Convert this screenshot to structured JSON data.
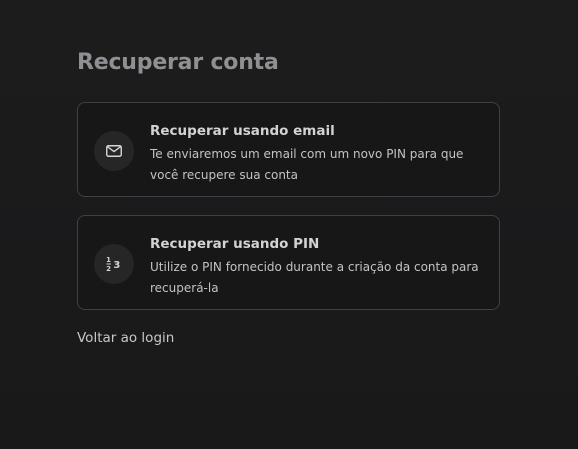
{
  "page": {
    "title": "Recuperar conta"
  },
  "options": [
    {
      "icon": "mail-icon",
      "title": "Recuperar usando email",
      "description": "Te enviaremos um email com um novo PIN para que você recupere sua conta"
    },
    {
      "icon": "fraction-numbers-icon",
      "icon_text": "½3",
      "title": "Recuperar usando PIN",
      "description": "Utilize o PIN fornecido durante a criação da conta para recuperá-la"
    }
  ],
  "footer": {
    "back_label": "Voltar ao login"
  },
  "colors": {
    "background": "#1b1b1c",
    "card_border": "#404043",
    "title": "#8f9093",
    "text": "#d3d3d5"
  }
}
